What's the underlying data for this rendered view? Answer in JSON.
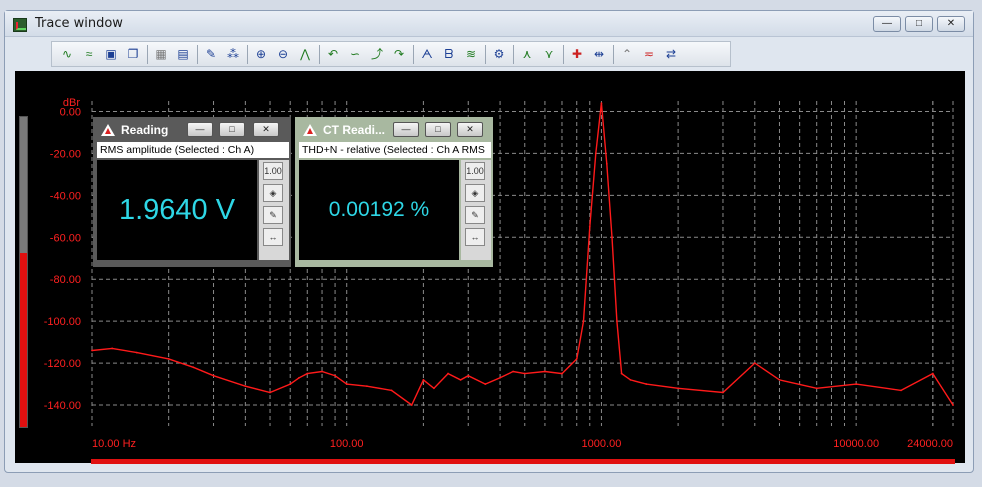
{
  "window": {
    "title": "Trace window",
    "minimize": "—",
    "maximize": "□",
    "close": "✕"
  },
  "toolbar": {
    "groups": [
      [
        {
          "icon": "add-trace-icon",
          "glyph": "∿",
          "color": "green"
        },
        {
          "icon": "trace-wave-icon",
          "glyph": "≈",
          "color": "green"
        },
        {
          "icon": "save-icon",
          "glyph": "▣",
          "color": "blue"
        },
        {
          "icon": "copy-icon",
          "glyph": "❐",
          "color": "blue"
        }
      ],
      [
        {
          "icon": "pattern-icon",
          "glyph": "▦",
          "color": "gray"
        },
        {
          "icon": "trace-list-icon",
          "glyph": "▤",
          "color": "blue"
        }
      ],
      [
        {
          "icon": "edit-icon",
          "glyph": "✎",
          "color": "blue"
        },
        {
          "icon": "numeric-icon",
          "glyph": "⁂",
          "color": "blue"
        }
      ],
      [
        {
          "icon": "zoom-in-icon",
          "glyph": "⊕",
          "color": "blue"
        },
        {
          "icon": "zoom-out-icon",
          "glyph": "⊖",
          "color": "blue"
        },
        {
          "icon": "autoscale-icon",
          "glyph": "⋀",
          "color": "green"
        }
      ],
      [
        {
          "icon": "cursor-left-icon",
          "glyph": "↶",
          "color": "green"
        },
        {
          "icon": "cursor-wave-icon",
          "glyph": "∽",
          "color": "green"
        },
        {
          "icon": "cursor-peak-icon",
          "glyph": "⤴",
          "color": "green"
        },
        {
          "icon": "cursor-right-icon",
          "glyph": "↷",
          "color": "green"
        }
      ],
      [
        {
          "icon": "marker-a-icon",
          "glyph": "ᗅ",
          "color": "blue"
        },
        {
          "icon": "marker-b-icon",
          "glyph": "ᗷ",
          "color": "blue"
        },
        {
          "icon": "marker-wave-icon",
          "glyph": "≋",
          "color": "green"
        }
      ],
      [
        {
          "icon": "settings-trace-icon",
          "glyph": "⚙",
          "color": "blue"
        }
      ],
      [
        {
          "icon": "peak-up-icon",
          "glyph": "⋏",
          "color": "green"
        },
        {
          "icon": "peak-down-icon",
          "glyph": "⋎",
          "color": "green"
        }
      ],
      [
        {
          "icon": "add-marker-icon",
          "glyph": "✚",
          "color": "red"
        },
        {
          "icon": "link-icon",
          "glyph": "⇹",
          "color": "blue"
        }
      ],
      [
        {
          "icon": "rise-icon",
          "glyph": "⌃",
          "color": "gray"
        },
        {
          "icon": "line-icon",
          "glyph": "≂",
          "color": "red"
        },
        {
          "icon": "swap-icon",
          "glyph": "⇄",
          "color": "blue"
        }
      ]
    ]
  },
  "reading_rms": {
    "title": "Reading",
    "subtitle": "RMS amplitude (Selected : Ch A)",
    "value": "1.9640 V",
    "color": "#5a5a5a",
    "side_buttons": [
      "1.00",
      "◈",
      "✎",
      "↔"
    ]
  },
  "reading_thd": {
    "title": "CT Readi...",
    "subtitle": "THD+N - relative (Selected : Ch A RMS",
    "value": "0.00192 %",
    "color": "#a8b8a0",
    "side_buttons": [
      "1.00",
      "◈",
      "✎",
      "↔"
    ]
  },
  "level_meter": {
    "fraction": 0.56
  },
  "chart_data": {
    "type": "line",
    "ylabel": "dBr",
    "y_ticks": [
      "0.00",
      "-20.00",
      "-40.00",
      "-60.00",
      "-80.00",
      "-100.00",
      "-120.00",
      "-140.00"
    ],
    "x_ticks": [
      "10.00 Hz",
      "100.00",
      "1000.00",
      "10000.00",
      "24000.00"
    ],
    "ylim": [
      -150,
      5
    ],
    "xlim": [
      10,
      24000
    ],
    "x_scale": "log",
    "grid": true,
    "trace_color": "#ff1a1a",
    "series": [
      {
        "x": [
          10,
          12,
          15,
          20,
          25,
          30,
          40,
          50,
          60,
          65,
          70,
          80,
          90,
          100,
          120,
          150,
          180,
          200,
          220,
          250,
          280,
          300,
          350,
          400,
          450,
          500,
          600,
          700,
          800,
          850,
          900,
          950,
          1000,
          1050,
          1100,
          1150,
          1200,
          1300,
          1500,
          2000,
          3000,
          4000,
          5000,
          7000,
          10000,
          15000,
          20000,
          24000
        ],
        "y": [
          -114,
          -113,
          -115,
          -118,
          -122,
          -126,
          -131,
          -134,
          -130,
          -127,
          -125,
          -124,
          -126,
          -130,
          -131,
          -133,
          -140,
          -128,
          -132,
          -125,
          -128,
          -126,
          -130,
          -127,
          -124,
          -125,
          -124,
          -125,
          -118,
          -100,
          -55,
          -20,
          4,
          -25,
          -60,
          -100,
          -125,
          -128,
          -130,
          -132,
          -134,
          -120,
          -128,
          -132,
          -130,
          -133,
          -125,
          -140
        ]
      }
    ]
  }
}
